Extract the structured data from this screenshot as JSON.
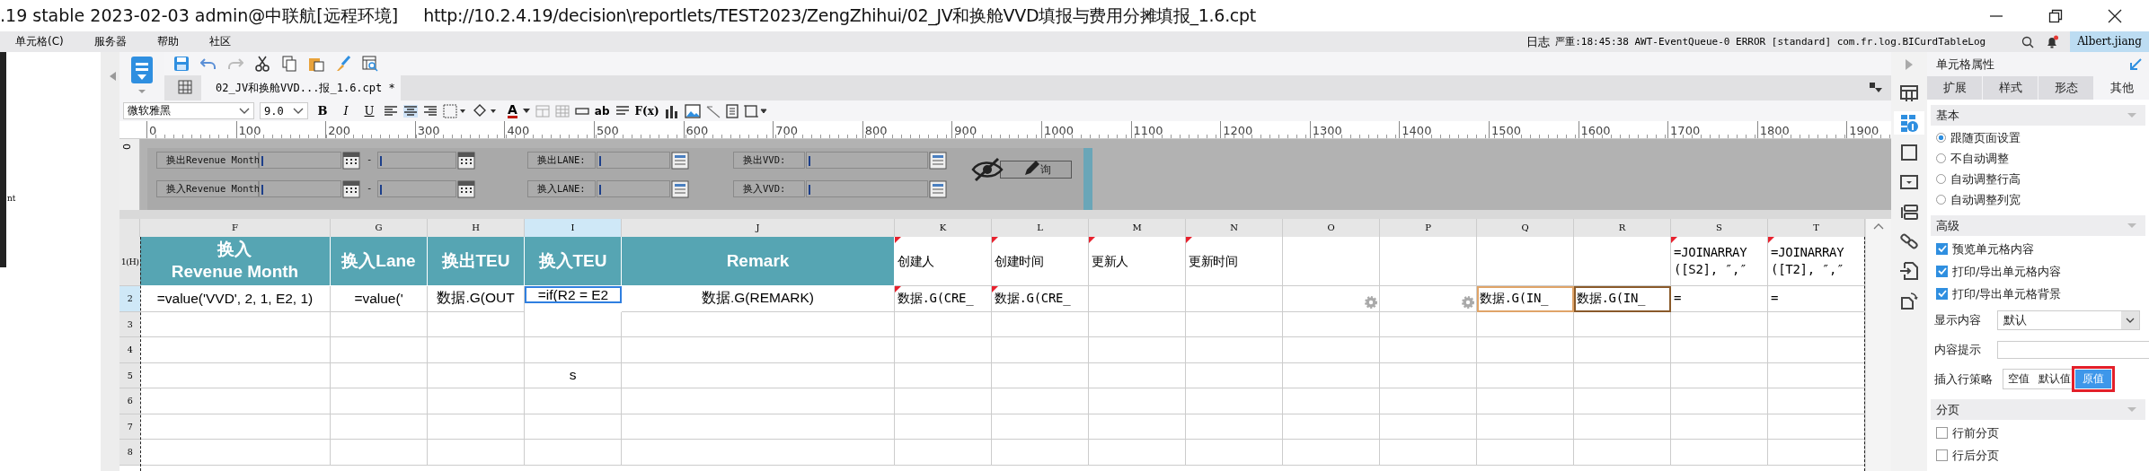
{
  "window": {
    "title": ".19 stable 2023-02-03 admin@中联航[远程环境]",
    "url": "http://10.2.4.19/decision\\reportlets/TEST2023/ZengZhihui/02_JV和换舱VVD填报与费用分摊填报_1.6.cpt"
  },
  "menu": [
    "单元格(C)",
    "服务器",
    "帮助",
    "社区"
  ],
  "status": {
    "log": "日志",
    "message": "严重:18:45:38 AWT-EventQueue-0 ERROR [standard] com.fr.log.BICurdTableLog",
    "user": "Albert.jiang"
  },
  "left_panel": {
    "text": "nt"
  },
  "editor_tab": {
    "title": "02_JV和换舱VVD...报_1.6.cpt *"
  },
  "format_bar": {
    "font": "微软雅黑",
    "size": "9.0",
    "style_buttons": [
      "B",
      "I",
      "U"
    ],
    "font_color": "A",
    "text_tools": [
      "ab",
      "F(x)"
    ]
  },
  "ruler": [
    "0",
    "100",
    "200",
    "300",
    "400",
    "500",
    "600",
    "700",
    "800",
    "900",
    "1000",
    "1100",
    "1200",
    "1300",
    "1400",
    "1500",
    "1600",
    "1700",
    "1800",
    "1900"
  ],
  "parameter_pane": {
    "date_ranges": [
      {
        "label": "换出Revenue Month",
        "separator": "-"
      },
      {
        "label": "换入Revenue Month",
        "separator": "-"
      }
    ],
    "lanes": [
      {
        "label": "换出LANE:"
      },
      {
        "label": "换入LANE:"
      }
    ],
    "vvds": [
      {
        "label": "换出VVD:"
      },
      {
        "label": "换入VVD:"
      }
    ],
    "query_button": "询",
    "vertical_ruler": "0"
  },
  "grid": {
    "columns": [
      "F",
      "G",
      "H",
      "I",
      "J",
      "K",
      "L",
      "M",
      "N",
      "O",
      "P",
      "Q",
      "R",
      "S",
      "T"
    ],
    "rows": [
      {
        "number": "1(H)",
        "cells": [
          {
            "text": "换入\nRevenue Month",
            "kind": "header",
            "selected": false,
            "flagged": false,
            "gear": false
          },
          {
            "text": "换入Lane",
            "kind": "header",
            "selected": false,
            "flagged": false,
            "gear": false
          },
          {
            "text": "换出TEU",
            "kind": "header",
            "selected": false,
            "flagged": false,
            "gear": false
          },
          {
            "text": "换入TEU",
            "kind": "header",
            "selected": false,
            "flagged": false,
            "gear": false
          },
          {
            "text": "Remark",
            "kind": "header",
            "selected": false,
            "flagged": false,
            "gear": false
          },
          {
            "text": "创建人",
            "kind": "mono",
            "selected": false,
            "flagged": true,
            "gear": false
          },
          {
            "text": "创建时间",
            "kind": "mono",
            "selected": false,
            "flagged": true,
            "gear": false
          },
          {
            "text": "更新人",
            "kind": "mono",
            "selected": false,
            "flagged": true,
            "gear": false
          },
          {
            "text": "更新时间",
            "kind": "mono",
            "selected": false,
            "flagged": true,
            "gear": false
          },
          {
            "selected": false,
            "flagged": false,
            "gear": false
          },
          {
            "selected": false,
            "flagged": false,
            "gear": false
          },
          {
            "selected": false,
            "flagged": false,
            "gear": false
          },
          {
            "selected": false,
            "flagged": false,
            "gear": false
          },
          {
            "text": "=JOINARRAY([S2], ″,″",
            "kind": "mono",
            "selected": false,
            "flagged": true,
            "gear": false
          },
          {
            "text": "=JOINARRAY([T2], ″,″",
            "kind": "mono",
            "selected": false,
            "flagged": true,
            "gear": false
          }
        ]
      },
      {
        "number": "2",
        "cells": [
          {
            "text": "=value('VVD', 2, 1, E2, 1)",
            "kind": "sans",
            "selected": false,
            "flagged": false,
            "gear": false
          },
          {
            "text": "=value('",
            "kind": "sans",
            "selected": false,
            "flagged": false,
            "gear": false
          },
          {
            "text": "数据.G(OUT",
            "kind": "sans",
            "selected": false,
            "flagged": false,
            "gear": false
          },
          {
            "text": "=if(R2 = E2",
            "kind": "sans",
            "selected": true,
            "flagged": false,
            "gear": false
          },
          {
            "text": "数据.G(REMARK)",
            "kind": "sans",
            "selected": false,
            "flagged": false,
            "gear": false
          },
          {
            "text": "数据.G(CRE_",
            "kind": "mono",
            "selected": false,
            "flagged": true,
            "gear": false
          },
          {
            "text": "数据.G(CRE_",
            "kind": "mono",
            "selected": false,
            "flagged": true,
            "gear": false
          },
          {
            "selected": false,
            "flagged": false,
            "gear": false
          },
          {
            "selected": false,
            "flagged": false,
            "gear": false
          },
          {
            "selected": false,
            "flagged": false,
            "gear": true
          },
          {
            "selected": false,
            "flagged": false,
            "gear": true
          },
          {
            "text": "数据.G(IN_",
            "kind": "mono",
            "selected": false,
            "flagged": false,
            "gear": false,
            "color": "#e0a468"
          },
          {
            "text": "数据.G(IN_",
            "kind": "mono",
            "selected": false,
            "flagged": false,
            "gear": false,
            "color": "#8a5a2a"
          },
          {
            "text": "=",
            "kind": "mono",
            "selected": false,
            "flagged": false,
            "gear": false
          },
          {
            "text": "=",
            "kind": "mono",
            "selected": false,
            "flagged": false,
            "gear": false
          }
        ]
      },
      {
        "number": "3",
        "cells": [
          {
            "selected": false
          },
          {
            "selected": false
          },
          {
            "selected": false
          },
          {
            "selected": false
          },
          {
            "selected": false
          },
          {
            "selected": false
          },
          {
            "selected": false
          },
          {
            "selected": false
          },
          {
            "selected": false
          },
          {
            "selected": false
          },
          {
            "selected": false
          },
          {
            "selected": false
          },
          {
            "selected": false
          },
          {
            "selected": false
          },
          {
            "selected": false
          }
        ]
      },
      {
        "number": "4",
        "cells": [
          {
            "selected": false
          },
          {
            "selected": false
          },
          {
            "selected": false
          },
          {
            "selected": false
          },
          {
            "selected": false
          },
          {
            "selected": false
          },
          {
            "selected": false
          },
          {
            "selected": false
          },
          {
            "selected": false
          },
          {
            "selected": false
          },
          {
            "selected": false
          },
          {
            "selected": false
          },
          {
            "selected": false
          },
          {
            "selected": false
          },
          {
            "selected": false
          }
        ]
      },
      {
        "number": "5",
        "cells": [
          {
            "selected": false
          },
          {
            "selected": false
          },
          {
            "selected": false
          },
          {
            "text": "s",
            "kind": "sans",
            "selected": false
          },
          {
            "selected": false
          },
          {
            "selected": false
          },
          {
            "selected": false
          },
          {
            "selected": false
          },
          {
            "selected": false
          },
          {
            "selected": false
          },
          {
            "selected": false
          },
          {
            "selected": false
          },
          {
            "selected": false
          },
          {
            "selected": false
          },
          {
            "selected": false
          }
        ]
      },
      {
        "number": "6",
        "cells": [
          {
            "selected": false
          },
          {
            "selected": false
          },
          {
            "selected": false
          },
          {
            "selected": false
          },
          {
            "selected": false
          },
          {
            "selected": false
          },
          {
            "selected": false
          },
          {
            "selected": false
          },
          {
            "selected": false
          },
          {
            "selected": false
          },
          {
            "selected": false
          },
          {
            "selected": false
          },
          {
            "selected": false
          },
          {
            "selected": false
          },
          {
            "selected": false
          }
        ]
      },
      {
        "number": "7",
        "cells": [
          {
            "selected": false
          },
          {
            "selected": false
          },
          {
            "selected": false
          },
          {
            "selected": false
          },
          {
            "selected": false
          },
          {
            "selected": false
          },
          {
            "selected": false
          },
          {
            "selected": false
          },
          {
            "selected": false
          },
          {
            "selected": false
          },
          {
            "selected": false
          },
          {
            "selected": false
          },
          {
            "selected": false
          },
          {
            "selected": false
          },
          {
            "selected": false
          }
        ]
      },
      {
        "number": "8",
        "cells": [
          {
            "selected": false
          },
          {
            "selected": false
          },
          {
            "selected": false
          },
          {
            "selected": false
          },
          {
            "selected": false
          },
          {
            "selected": false
          },
          {
            "selected": false
          },
          {
            "selected": false
          },
          {
            "selected": false
          },
          {
            "selected": false
          },
          {
            "selected": false
          },
          {
            "selected": false
          },
          {
            "selected": false
          },
          {
            "selected": false
          },
          {
            "selected": false
          }
        ]
      }
    ]
  },
  "properties": {
    "title": "单元格属性",
    "tabs": [
      {
        "label": "扩展",
        "selected": false
      },
      {
        "label": "样式",
        "selected": false
      },
      {
        "label": "形态",
        "selected": false
      },
      {
        "label": "其他",
        "selected": true
      }
    ],
    "basic": {
      "title": "基本",
      "options": [
        {
          "label": "跟随页面设置",
          "selected": true
        },
        {
          "label": "不自动调整",
          "selected": false
        },
        {
          "label": "自动调整行高",
          "selected": false
        },
        {
          "label": "自动调整列宽",
          "selected": false
        }
      ]
    },
    "advanced": {
      "title": "高级",
      "checks": [
        {
          "label": "预览单元格内容",
          "checked": true
        },
        {
          "label": "打印/导出单元格内容",
          "checked": true
        },
        {
          "label": "打印/导出单元格背景",
          "checked": true
        }
      ],
      "display": {
        "label": "显示内容",
        "value": "默认"
      },
      "hint": {
        "label": "内容提示"
      },
      "insert_policy": {
        "label": "插入行策略",
        "options": [
          {
            "label": "空值",
            "selected": false,
            "highlighted": false
          },
          {
            "label": "默认值",
            "selected": false,
            "highlighted": false
          },
          {
            "label": "原值",
            "selected": true,
            "highlighted": true
          }
        ]
      }
    },
    "paging": {
      "title": "分页",
      "checks": [
        {
          "label": "行前分页",
          "checked": false
        },
        {
          "label": "行后分页",
          "checked": false
        }
      ]
    }
  }
}
